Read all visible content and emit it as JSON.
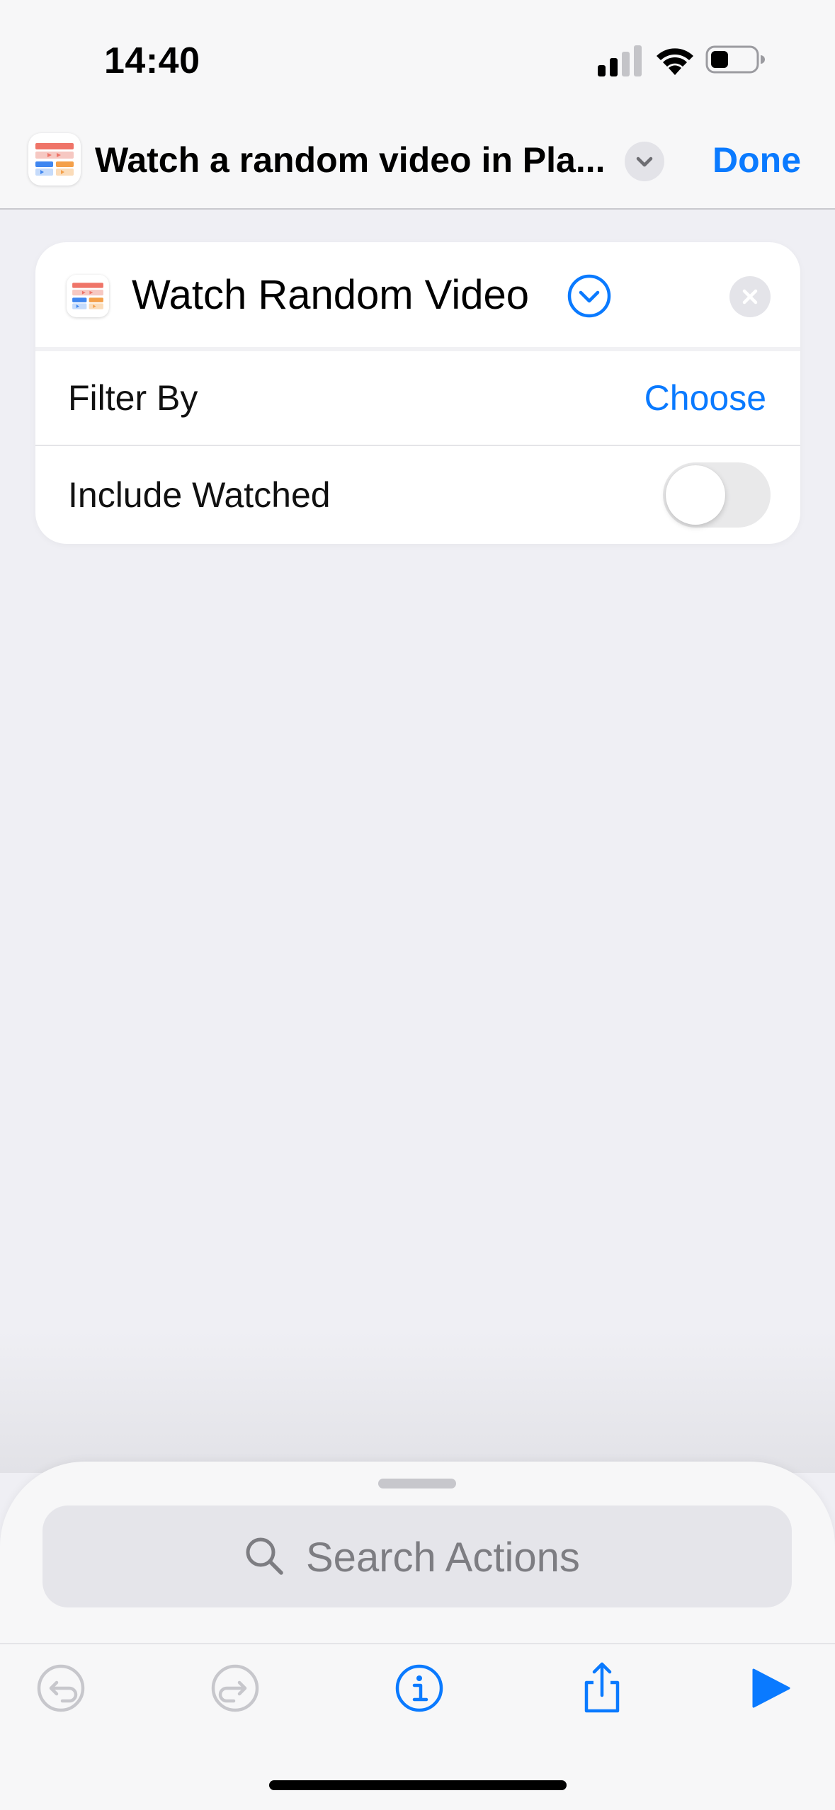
{
  "status_bar": {
    "time": "14:40"
  },
  "nav": {
    "title": "Watch a random video in Pla...",
    "done_label": "Done"
  },
  "action": {
    "title": "Watch Random Video",
    "rows": [
      {
        "label": "Filter By",
        "value": "Choose"
      },
      {
        "label": "Include Watched",
        "toggle_on": false
      }
    ]
  },
  "search": {
    "placeholder": "Search Actions"
  },
  "toolbar": {
    "icons": [
      "undo-icon",
      "redo-icon",
      "info-icon",
      "share-icon",
      "play-icon"
    ]
  },
  "colors": {
    "accent": "#0a7aff",
    "background": "#efeff4",
    "card": "#ffffff",
    "disabled": "#c7c7cc"
  }
}
